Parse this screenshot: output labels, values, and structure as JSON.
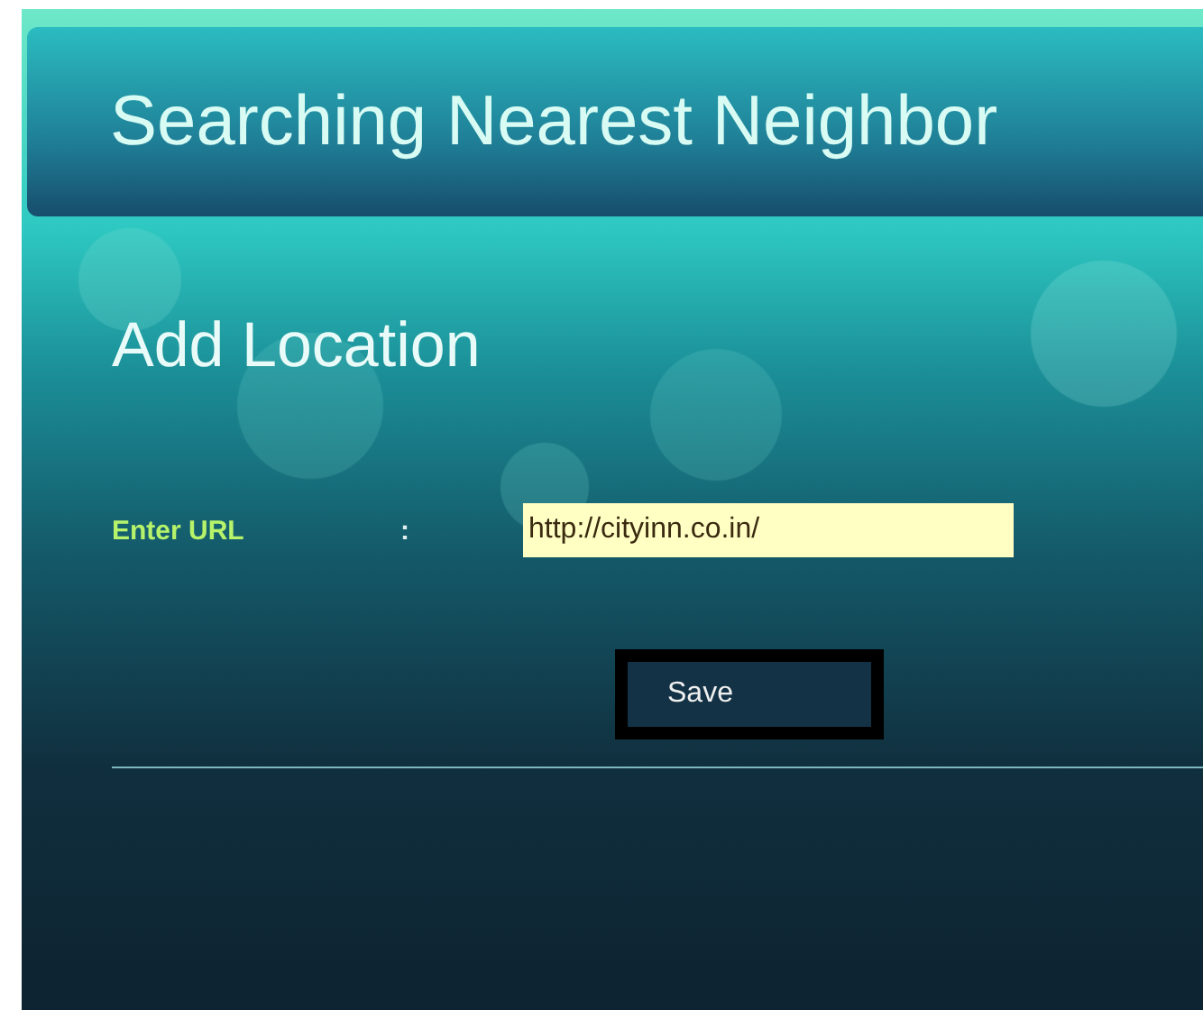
{
  "header": {
    "title": "Searching Nearest Neighbor"
  },
  "section": {
    "title": "Add Location"
  },
  "form": {
    "fields": [
      {
        "label": "Enter URL",
        "separator": ":",
        "value": "http://cityinn.co.in/"
      }
    ],
    "buttons": [
      {
        "label": "Save"
      }
    ]
  }
}
